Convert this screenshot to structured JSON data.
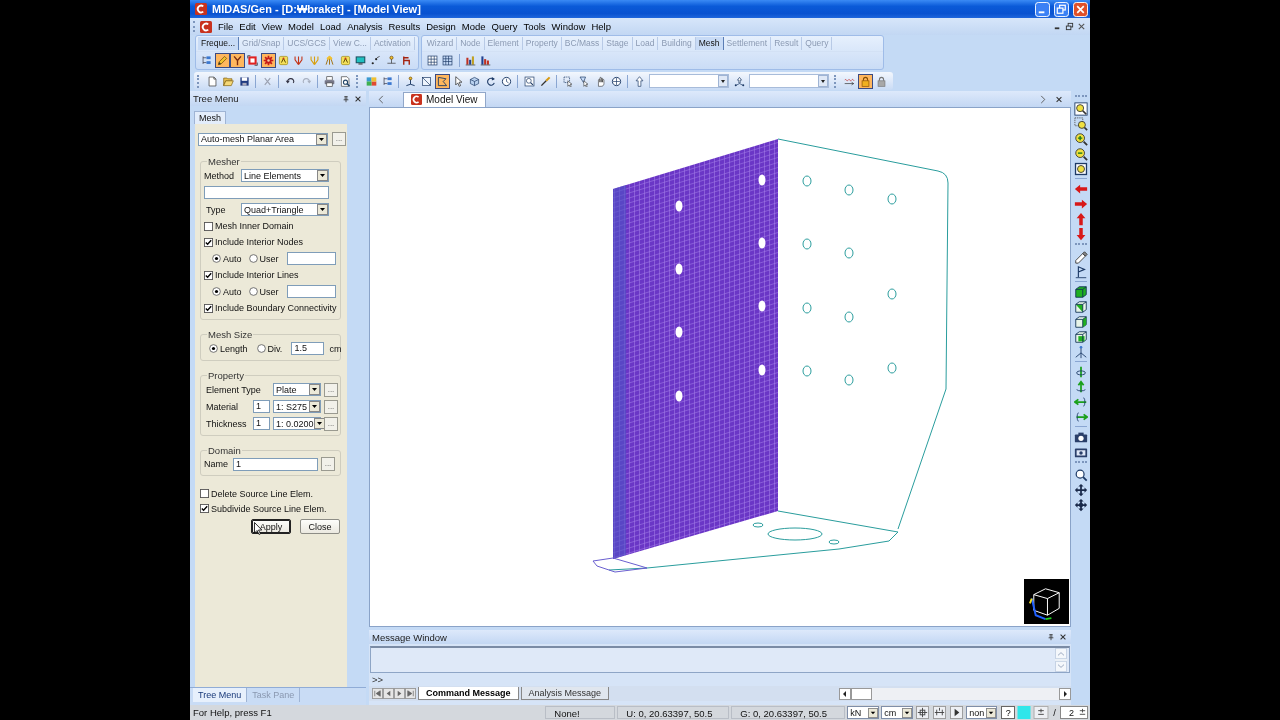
{
  "window": {
    "title": "MIDAS/Gen - [D:₩braket] - [Model View]"
  },
  "menu": [
    "File",
    "Edit",
    "View",
    "Model",
    "Load",
    "Analysis",
    "Results",
    "Design",
    "Mode",
    "Query",
    "Tools",
    "Window",
    "Help"
  ],
  "command_panels": [
    {
      "tabs": [
        {
          "label": "Freque...",
          "selected": true
        },
        {
          "label": "Grid/Snap",
          "selected": false
        },
        {
          "label": "UCS/GCS",
          "selected": false
        },
        {
          "label": "View C...",
          "selected": false
        },
        {
          "label": "Activation",
          "selected": false
        }
      ],
      "buttons": [
        {
          "pressed": false
        },
        {
          "pressed": true
        },
        {
          "pressed": true
        },
        {
          "pressed": false
        },
        {
          "pressed": true
        },
        {
          "pressed": false
        },
        {
          "pressed": false
        },
        {
          "pressed": false
        },
        {
          "pressed": false
        },
        {
          "pressed": false
        },
        {
          "pressed": false
        },
        {
          "pressed": false
        },
        {
          "pressed": false
        },
        {
          "pressed": false
        }
      ]
    },
    {
      "tabs": [
        {
          "label": "Wizard",
          "selected": false
        },
        {
          "label": "Node",
          "selected": false
        },
        {
          "label": "Element",
          "selected": false
        },
        {
          "label": "Property",
          "selected": false
        },
        {
          "label": "BC/Mass",
          "selected": false
        },
        {
          "label": "Stage",
          "selected": false
        },
        {
          "label": "Load",
          "selected": false
        },
        {
          "label": "Building",
          "selected": false
        },
        {
          "label": "Mesh",
          "selected": true
        },
        {
          "label": "Settlement",
          "selected": false
        },
        {
          "label": "Result",
          "selected": false
        },
        {
          "label": "Query",
          "selected": false
        }
      ],
      "buttons": [
        {
          "pressed": false
        },
        {
          "pressed": false
        },
        {
          "pressed": false
        },
        {
          "pressed": false
        }
      ]
    }
  ],
  "main_toolbar": {
    "buttons": [
      {
        "pressed": false
      },
      {
        "pressed": false
      },
      {
        "pressed": false
      },
      {
        "pressed": false
      },
      {
        "pressed": false
      },
      {
        "pressed": false
      },
      {
        "pressed": false
      },
      {
        "pressed": false
      },
      {
        "pressed": false
      },
      {
        "pressed": false
      },
      {
        "pressed": false
      },
      {
        "pressed": false
      },
      {
        "pressed": true
      },
      {
        "pressed": false
      },
      {
        "pressed": false
      },
      {
        "pressed": false
      },
      {
        "pressed": false
      },
      {
        "pressed": false
      },
      {
        "pressed": false
      },
      {
        "pressed": false
      },
      {
        "pressed": false
      },
      {
        "pressed": false
      },
      {
        "pressed": false
      },
      {
        "pressed": false
      },
      {
        "pressed": false
      },
      {
        "pressed": false
      },
      {
        "pressed": true
      },
      {
        "pressed": false
      }
    ]
  },
  "tree_menu": {
    "title": "Tree Menu",
    "tabs": [
      {
        "label": "Mesh",
        "selected": true
      }
    ],
    "command": "Auto-mesh Planar Area",
    "command_button": "...",
    "mesher": {
      "title": "Mesher",
      "method_label": "Method",
      "method": "Line Elements",
      "type_label": "Type",
      "type": "Quad+Triangle",
      "options": [
        {
          "kind": "checkbox",
          "label": "Mesh Inner Domain",
          "checked": false
        },
        {
          "kind": "checkbox",
          "label": "Include Interior Nodes",
          "checked": true
        },
        {
          "kind": "radio",
          "choices": [
            {
              "label": "Auto",
              "selected": true
            },
            {
              "label": "User",
              "selected": false
            }
          ]
        },
        {
          "kind": "checkbox",
          "label": "Include Interior Lines",
          "checked": true
        },
        {
          "kind": "radio",
          "choices": [
            {
              "label": "Auto",
              "selected": true
            },
            {
              "label": "User",
              "selected": false
            }
          ]
        },
        {
          "kind": "checkbox",
          "label": "Include Boundary Connectivity",
          "checked": true
        }
      ]
    },
    "mesh_size": {
      "title": "Mesh Size",
      "choices": [
        {
          "label": "Length",
          "selected": true
        },
        {
          "label": "Div.",
          "selected": false
        }
      ],
      "value": "1.5",
      "unit": "cm"
    },
    "property": {
      "title": "Property",
      "rows": [
        {
          "label": "Element Type",
          "value": "Plate",
          "button": "..."
        },
        {
          "label": "Material",
          "number": "1",
          "value": "1: S275",
          "button": "..."
        },
        {
          "label": "Thickness",
          "number": "1",
          "value": "1: 0.0200",
          "button": "..."
        }
      ]
    },
    "domain": {
      "title": "Domain",
      "label": "Name",
      "value": "1",
      "button": "..."
    },
    "options": [
      {
        "label": "Delete Source Line Elem.",
        "checked": false
      },
      {
        "label": "Subdivide Source Line Elem.",
        "checked": true
      }
    ],
    "buttons": [
      {
        "label": "Apply",
        "focused": true
      },
      {
        "label": "Close",
        "focused": false
      }
    ],
    "bottom_tabs": [
      {
        "label": "Tree Menu",
        "selected": true
      },
      {
        "label": "Task Pane",
        "selected": false
      }
    ]
  },
  "model_view": {
    "tabs": [
      {
        "label": "Model View",
        "selected": true
      }
    ]
  },
  "message_window": {
    "title": "Message Window",
    "prompt": ">>",
    "tabs": [
      {
        "label": "Command Message",
        "selected": true
      },
      {
        "label": "Analysis Message",
        "selected": false
      }
    ]
  },
  "status_bar": {
    "help": "For Help, press F1",
    "selection": "None!",
    "ucs": "U: 0, 20.63397, 50.5",
    "gcs": "G: 0, 20.63397, 50.5",
    "force_unit": "kN",
    "length_unit": "cm",
    "filter": "non",
    "help_button": "?",
    "separator": "/",
    "page": "2"
  }
}
